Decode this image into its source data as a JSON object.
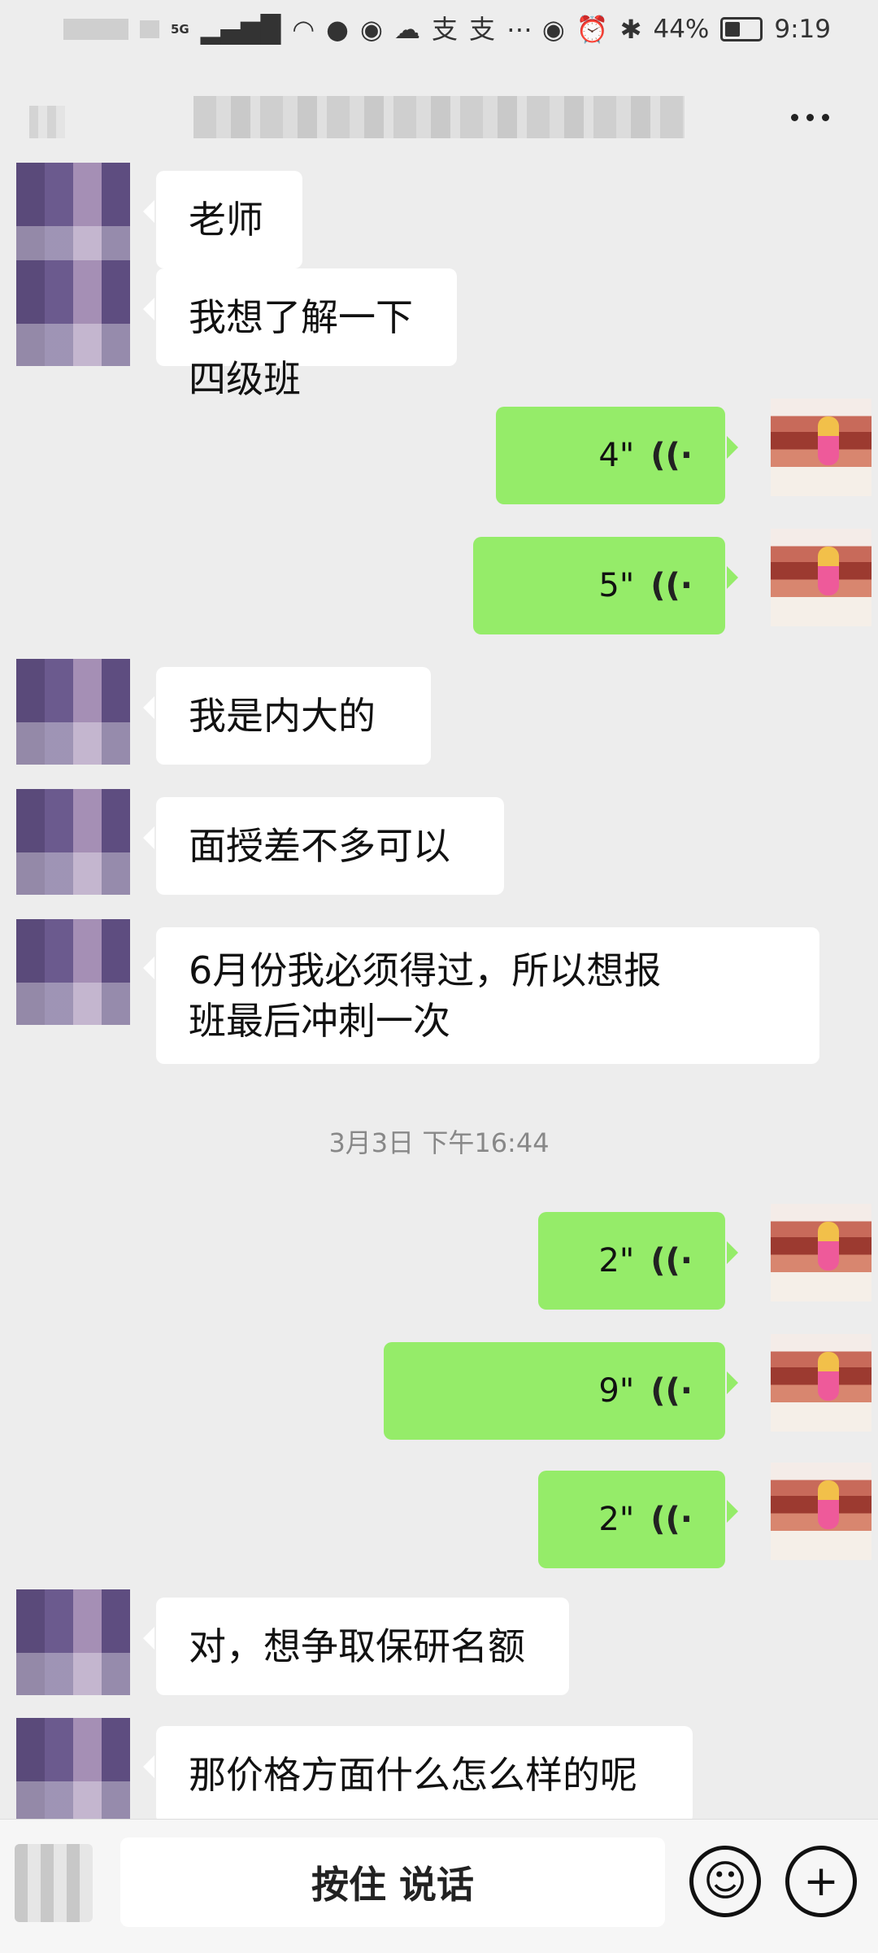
{
  "status_bar": {
    "network": "5G",
    "battery_level": "44%",
    "battery_fill": 0.44,
    "time": "9:19"
  },
  "header": {
    "title": "",
    "more_icon": "more-icon"
  },
  "messages": [
    {
      "side": "in",
      "text": "老师",
      "lines": [
        "老师"
      ]
    },
    {
      "side": "in",
      "text": "我想了解一下四级班",
      "lines": [
        "我想了解一下四级班"
      ]
    },
    {
      "side": "out",
      "voice": "4\""
    },
    {
      "side": "out",
      "voice": "5\""
    },
    {
      "side": "in",
      "text": "我是内大的",
      "lines": [
        "我是内大的"
      ]
    },
    {
      "side": "in",
      "text": "面授差不多可以",
      "lines": [
        "面授差不多可以"
      ]
    },
    {
      "side": "in",
      "lines": [
        "6月份我必须得过，所以想报",
        "班最后冲刺一次"
      ]
    },
    {
      "timestamp": "3月3日 下午16:44"
    },
    {
      "side": "out",
      "voice": "2\""
    },
    {
      "side": "out",
      "voice": "9\""
    },
    {
      "side": "out",
      "voice": "2\""
    },
    {
      "side": "in",
      "lines": [
        "对，想争取保研名额"
      ]
    },
    {
      "side": "in",
      "lines": [
        "那价格方面什么怎么样的呢"
      ]
    }
  ],
  "input_bar": {
    "hold_to_talk_label": "按住 说话",
    "emoji_icon": "emoji-icon",
    "plus_icon": "plus-icon"
  }
}
